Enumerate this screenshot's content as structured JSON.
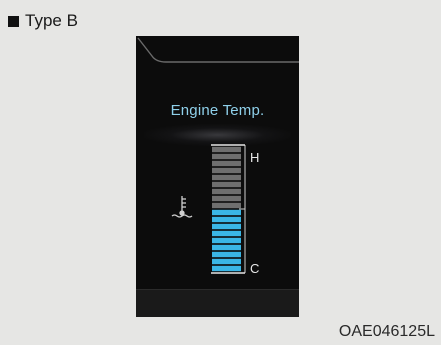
{
  "header": {
    "label": "Type B"
  },
  "display": {
    "title": "Engine Temp.",
    "hot_label": "H",
    "cold_label": "C",
    "total_segments": 18,
    "lit_segments": 9,
    "colors": {
      "lit": "#3ab6e6",
      "unlit": "#6f6f6f",
      "title": "#8fd0ea"
    },
    "icon": "coolant-temperature-icon"
  },
  "footer": {
    "code": "OAE046125L"
  }
}
